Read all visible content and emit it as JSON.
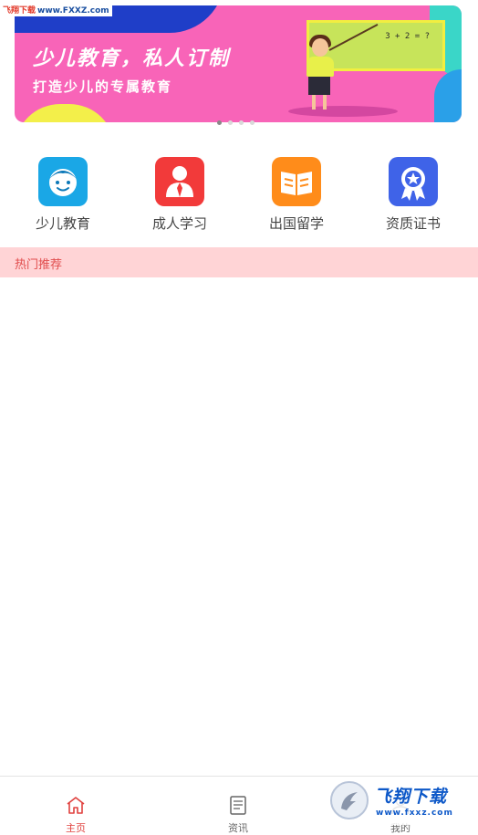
{
  "watermark": {
    "top_left_brand": "飞翔下载",
    "top_left_url": "www.FXXZ.com",
    "bottom_right_brand": "飞翔下载",
    "bottom_right_url": "www.fxxz.com"
  },
  "banner": {
    "title": "少儿教育，私人订制",
    "subtitle": "打造少儿的专属教育",
    "board_text": "3 + 2 = ?",
    "page_count": 4,
    "active_page": 1
  },
  "categories": [
    {
      "label": "少儿教育",
      "icon": "child-face-icon",
      "color": "#1aa7e6"
    },
    {
      "label": "成人学习",
      "icon": "adult-person-icon",
      "color": "#f23a3a"
    },
    {
      "label": "出国留学",
      "icon": "open-book-icon",
      "color": "#ff8c1a"
    },
    {
      "label": "资质证书",
      "icon": "award-badge-icon",
      "color": "#3f63e8"
    }
  ],
  "hot": {
    "label": "热门推荐"
  },
  "bottom_nav": {
    "items": [
      {
        "label": "主页",
        "icon": "home-icon",
        "active": true
      },
      {
        "label": "资讯",
        "icon": "news-icon",
        "active": false
      },
      {
        "label": "我的",
        "icon": "profile-icon",
        "active": false
      }
    ]
  },
  "colors": {
    "accent": "#e0413e",
    "hot_bar_bg": "#ffd4d6"
  }
}
